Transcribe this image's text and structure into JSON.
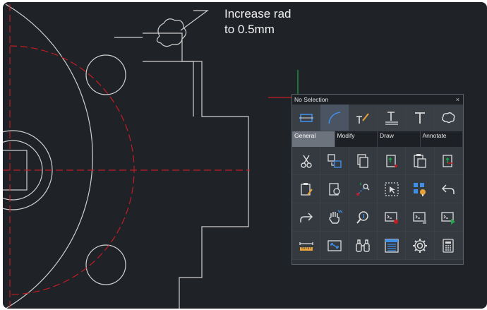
{
  "annotation": {
    "line1": "Increase rad",
    "line2": "to 0.5mm"
  },
  "palette": {
    "title": "No Selection",
    "close_glyph": "×",
    "top_icons": [
      "rectangle-select-icon",
      "arc-icon",
      "text-brush-icon",
      "multiline-text-icon",
      "text-icon",
      "revision-cloud-icon"
    ],
    "tabs": [
      {
        "label": "General",
        "active": true
      },
      {
        "label": "Modify",
        "active": false
      },
      {
        "label": "Draw",
        "active": false
      },
      {
        "label": "Annotate",
        "active": false
      }
    ],
    "tools": [
      "cut-icon",
      "copy-icon",
      "copy-clip-icon",
      "paste-block-icon",
      "paste-icon",
      "paste-coords-icon",
      "paste-special-icon",
      "clipboard-view-icon",
      "ucs-icon",
      "select-icon",
      "quick-select-icon",
      "undo-icon",
      "redo-icon",
      "pan-icon",
      "zoom-icon",
      "command-stop-icon",
      "command-line-icon",
      "run-script-icon",
      "measure-icon",
      "zoom-extents-icon",
      "find-icon",
      "properties-icon",
      "settings-icon",
      "calculator-icon"
    ]
  },
  "colors": {
    "canvas": "#1f2227",
    "geometry": "#d0d0d0",
    "centerline": "#c21d24",
    "ucs_y": "#1ea84a",
    "accent_blue": "#3f8ee8",
    "accent_orange": "#e8a23a"
  }
}
